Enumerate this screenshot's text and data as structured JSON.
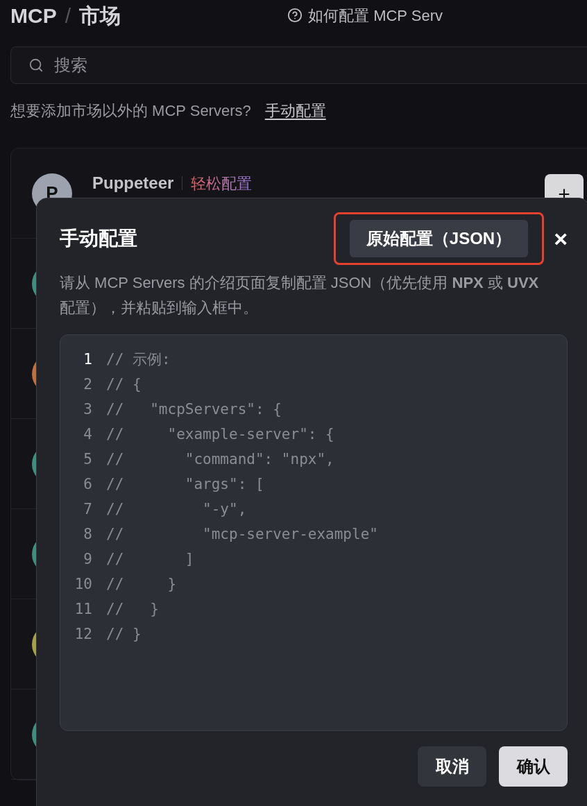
{
  "header": {
    "title": "MCP",
    "separator": "/",
    "subtitle": "市场",
    "help_link": "如何配置 MCP Serv"
  },
  "search": {
    "placeholder": "搜索"
  },
  "hint": {
    "text": "想要添加市场以外的 MCP Servers?",
    "link": "手动配置"
  },
  "servers": [
    {
      "avatar": "P",
      "name": "Puppeteer",
      "tag": "轻松配置",
      "add": "+",
      "color": "#9ca3af"
    },
    {
      "color": "#3f8f7f"
    },
    {
      "color": "#c0703d"
    },
    {
      "color": "#3f8f7f"
    },
    {
      "color": "#3f8f7f"
    },
    {
      "color": "#a7a04a"
    },
    {
      "color": "#3f8f7f"
    }
  ],
  "dialog": {
    "title": "手动配置",
    "mode_button": "原始配置（JSON）",
    "highlighted": true,
    "close": "×",
    "description": "请从 MCP Servers 的介绍页面复制配置 JSON（优先使用 **NPX** 或 **UVX** 配置），并粘贴到输入框中。",
    "editor": [
      {
        "number": "1",
        "code": "// 示例:",
        "selected": true
      },
      {
        "number": "2",
        "code": "// {",
        "selected": false
      },
      {
        "number": "3",
        "code": "//   \"mcpServers\": {",
        "selected": false
      },
      {
        "number": "4",
        "code": "//     \"example-server\": {",
        "selected": false
      },
      {
        "number": "5",
        "code": "//       \"command\": \"npx\",",
        "selected": false
      },
      {
        "number": "6",
        "code": "//       \"args\": [",
        "selected": false
      },
      {
        "number": "7",
        "code": "//         \"-y\",",
        "selected": false
      },
      {
        "number": "8",
        "code": "//         \"mcp-server-example\"",
        "selected": false
      },
      {
        "number": "9",
        "code": "//       ]",
        "selected": false
      },
      {
        "number": "10",
        "code": "//     }",
        "selected": false
      },
      {
        "number": "11",
        "code": "//   }",
        "selected": false
      },
      {
        "number": "12",
        "code": "// }",
        "selected": false
      }
    ],
    "buttons": [
      {
        "label": "取消",
        "kind": "secondary"
      },
      {
        "label": "确认",
        "kind": "primary"
      }
    ]
  }
}
